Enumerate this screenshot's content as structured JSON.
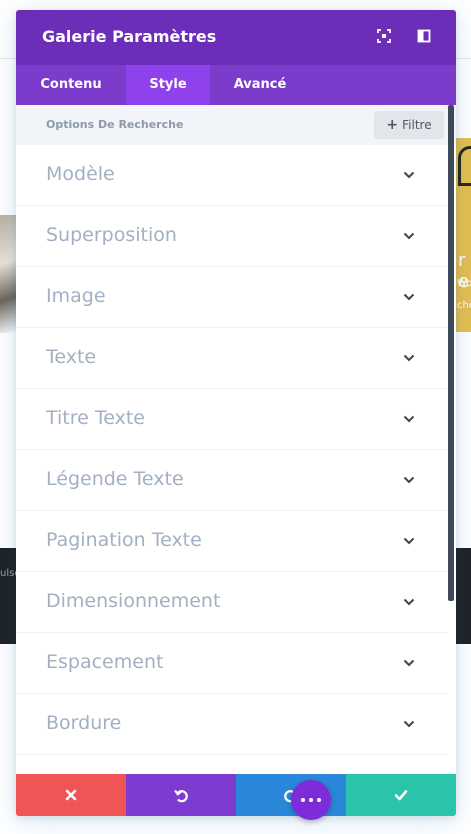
{
  "modal": {
    "title": "Galerie Paramètres",
    "header_icons": [
      "expand-icon",
      "split-view-icon"
    ]
  },
  "tabs": [
    {
      "label": "Contenu",
      "active": false
    },
    {
      "label": "Style",
      "active": true
    },
    {
      "label": "Avancé",
      "active": false
    }
  ],
  "search": {
    "placeholder": "Options De Recherche",
    "filter_label": "Filtre"
  },
  "toggles": [
    {
      "label": "Modèle"
    },
    {
      "label": "Superposition"
    },
    {
      "label": "Image"
    },
    {
      "label": "Texte"
    },
    {
      "label": "Titre Texte"
    },
    {
      "label": "Légende Texte"
    },
    {
      "label": "Pagination Texte"
    },
    {
      "label": "Dimensionnement"
    },
    {
      "label": "Espacement"
    },
    {
      "label": "Bordure"
    }
  ],
  "footer": {
    "buttons": [
      "close-icon",
      "undo-icon",
      "redo-icon",
      "check-icon"
    ]
  },
  "background": {
    "right_card_text": [
      "r e",
      "Wo",
      "che"
    ],
    "dark_band_text": "ulse"
  },
  "colors": {
    "header": "#6c2eb9",
    "tabs": "#7b3ccc",
    "active_tab": "#8f42ec",
    "cancel": "#ef5555",
    "undo": "#7e3bd0",
    "redo": "#2b87da",
    "save": "#29c4a9",
    "fab": "#7e2bd9"
  }
}
